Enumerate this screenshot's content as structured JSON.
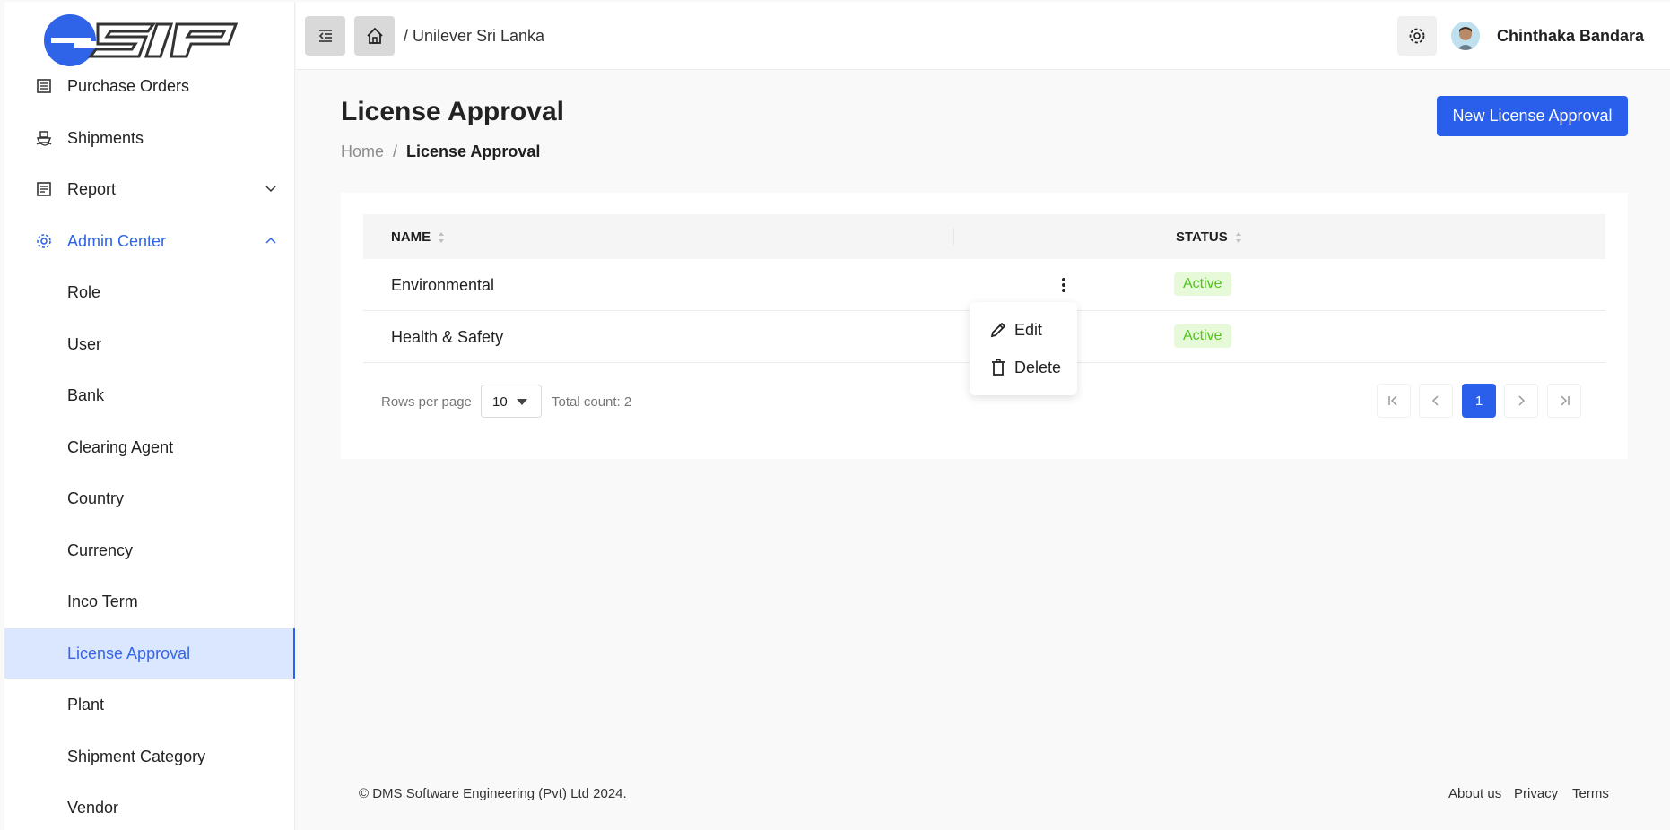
{
  "sidebar": {
    "logo_text": "esip",
    "items": [
      {
        "label": "Purchase Orders",
        "icon": "document-list-icon"
      },
      {
        "label": "Shipments",
        "icon": "ship-icon"
      },
      {
        "label": "Report",
        "icon": "report-icon"
      },
      {
        "label": "Admin Center",
        "icon": "gear-icon"
      }
    ],
    "admin_items": [
      {
        "label": "Role"
      },
      {
        "label": "User"
      },
      {
        "label": "Bank"
      },
      {
        "label": "Clearing Agent"
      },
      {
        "label": "Country"
      },
      {
        "label": "Currency"
      },
      {
        "label": "Inco Term"
      },
      {
        "label": "License Approval"
      },
      {
        "label": "Plant"
      },
      {
        "label": "Shipment Category"
      },
      {
        "label": "Vendor"
      }
    ]
  },
  "header": {
    "breadcrumb": "/ Unilever Sri Lanka",
    "username": "Chinthaka Bandara"
  },
  "page": {
    "title": "License Approval",
    "breadcrumb_home": "Home",
    "breadcrumb_sep": "/",
    "breadcrumb_current": "License Approval",
    "new_button": "New License Approval"
  },
  "table": {
    "columns": [
      "NAME",
      "STATUS"
    ],
    "rows": [
      {
        "name": "Environmental",
        "status": "Active"
      },
      {
        "name": "Health & Safety",
        "status": "Active"
      }
    ]
  },
  "pagination": {
    "rows_per_page_label": "Rows per page",
    "rows_per_page_value": "10",
    "total_count": "Total count: 2",
    "current_page": "1"
  },
  "context_menu": {
    "edit": "Edit",
    "delete": "Delete"
  },
  "footer": {
    "copyright": "© DMS Software Engineering (Pvt) Ltd 2024.",
    "about": "About us",
    "privacy": "Privacy",
    "terms": "Terms"
  },
  "colors": {
    "primary": "#2a5fec",
    "active_bg": "#dbe6ff",
    "status_green": "#52c41a"
  }
}
